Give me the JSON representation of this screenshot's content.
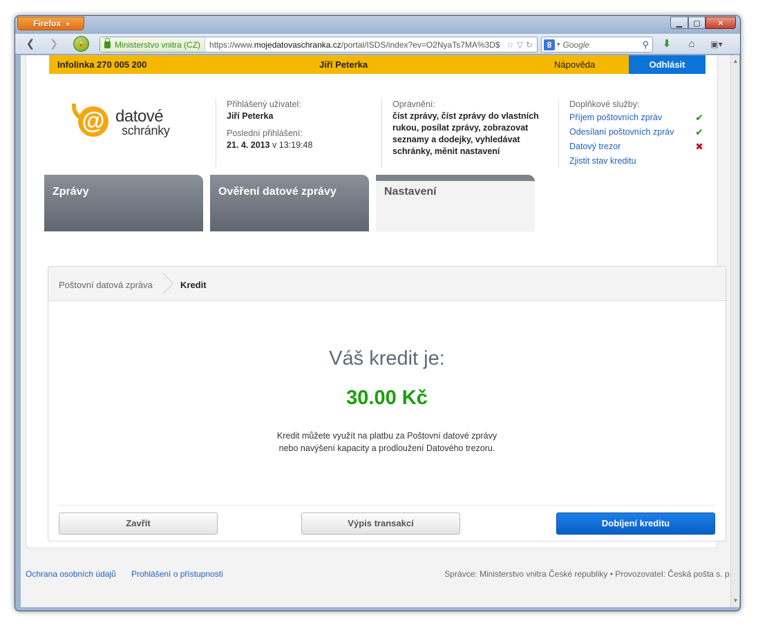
{
  "browser": {
    "app_button": "Firefox",
    "identity": "Ministerstvo vnitra (CZ)",
    "url_prefix": "https://www.",
    "url_domain": "mojedatovaschranka.cz",
    "url_rest": "/portal/ISDS/index?ev=O2NyaTs7MA%3D$",
    "search_placeholder": "Google"
  },
  "topbar": {
    "hotline": "Infolinka 270 005 200",
    "user": "Jiří Peterka",
    "help": "Nápověda",
    "logout": "Odhlásit"
  },
  "logo": {
    "line1": "datové",
    "line2": "schránky"
  },
  "user_info": {
    "logged_label": "Přihlášený uživatel:",
    "logged_name": "Jiří Peterka",
    "last_login_label": "Poslední přihlášení:",
    "last_login_date": "21. 4. 2013",
    "last_login_time": " v 13:19:48"
  },
  "permissions": {
    "label": "Oprávnění:",
    "text": "číst zprávy, číst zprávy do vlastních rukou, posílat zprávy, zobrazovat seznamy a dodejky, vyhledávat schránky, měnit nastavení"
  },
  "services": {
    "label": "Doplňkové služby:",
    "items": [
      {
        "label": "Příjem poštovních zpráv",
        "status": "✔"
      },
      {
        "label": "Odesílaní poštovních zpráv",
        "status": "✔"
      },
      {
        "label": "Datový trezor",
        "status": "✖"
      },
      {
        "label": "Zjistit stav kreditu",
        "status": ""
      }
    ]
  },
  "tabs": [
    {
      "label": "Zprávy"
    },
    {
      "label": "Ověření datové zprávy"
    },
    {
      "label": "Nastavení"
    }
  ],
  "breadcrumb": {
    "item1": "Poštovní datová zpráva",
    "item2": "Kredit"
  },
  "credit": {
    "title": "Váš kredit je:",
    "value": "30.00 Kč",
    "note_line1": "Kredit můžete využít na platbu za Poštovní datové zprávy",
    "note_line2": "nebo navýšení kapacity a prodloužení Datového trezoru."
  },
  "buttons": {
    "close": "Zavřít",
    "transactions": "Výpis transakcí",
    "topup": "Dobíjení kreditu"
  },
  "footer": {
    "privacy": "Ochrana osobních údajů",
    "accessibility": "Prohlášení o přístupnosti",
    "operator": "Správce: Ministerstvo vnitra České republiky • Provozovatel: Česká pošta s. p."
  },
  "colors": {
    "accent_yellow": "#f5b800",
    "logout_blue": "#0c73d8",
    "credit_green": "#17a00b",
    "ok_green": "#1c9a0a",
    "no_red": "#c0142a"
  }
}
